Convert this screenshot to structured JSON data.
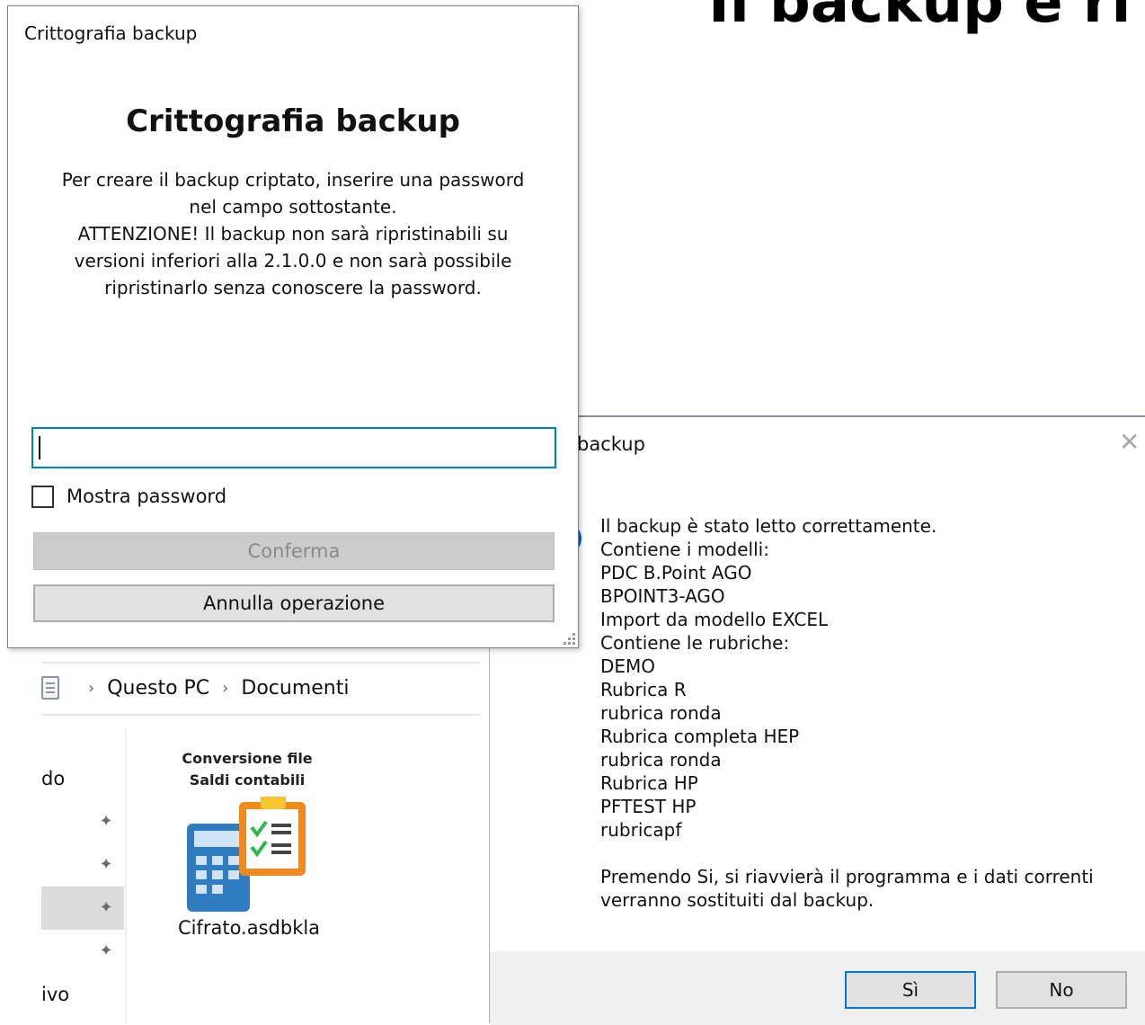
{
  "background": {
    "headline": "Il backup è ri"
  },
  "explorer": {
    "breadcrumb": [
      "Questo PC",
      "Documenti"
    ],
    "nav_items": [
      "do",
      "ivo"
    ],
    "file": {
      "thumbnail_label_line1": "Conversione file",
      "thumbnail_label_line2": "Saldi contabili",
      "name": "Cifrato.asdbkla",
      "icon": "calculator-checklist-icon"
    }
  },
  "result_dialog": {
    "title": "backup",
    "lines": [
      "Il backup è stato letto correttamente.",
      "Contiene i modelli:",
      "PDC B.Point AGO",
      "BPOINT3-AGO",
      "Import da modello EXCEL",
      "Contiene le rubriche:",
      "DEMO",
      "Rubrica R",
      "rubrica ronda",
      "Rubrica completa HEP",
      "rubrica ronda",
      "Rubrica HP",
      "PFTEST HP",
      "rubricapf",
      "",
      "Premendo Si, si riavvierà il programma e i dati correnti",
      "verranno sostituiti dal backup."
    ],
    "yes_label": "Sì",
    "no_label": "No"
  },
  "crypto_dialog": {
    "window_title": "Crittografia backup",
    "heading": "Crittografia backup",
    "description": [
      "Per creare il backup criptato, inserire una password",
      "nel campo sottostante.",
      "ATTENZIONE! Il backup non sarà ripristinabili su",
      "versioni inferiori alla 2.1.0.0 e non sarà possibile",
      "ripristinarlo senza conoscere la password."
    ],
    "password_value": "",
    "show_password_label": "Mostra password",
    "show_password_checked": false,
    "confirm_label": "Conferma",
    "cancel_label": "Annulla operazione"
  },
  "colors": {
    "accent": "#0078d7",
    "info_icon": "#0b5fb4"
  }
}
